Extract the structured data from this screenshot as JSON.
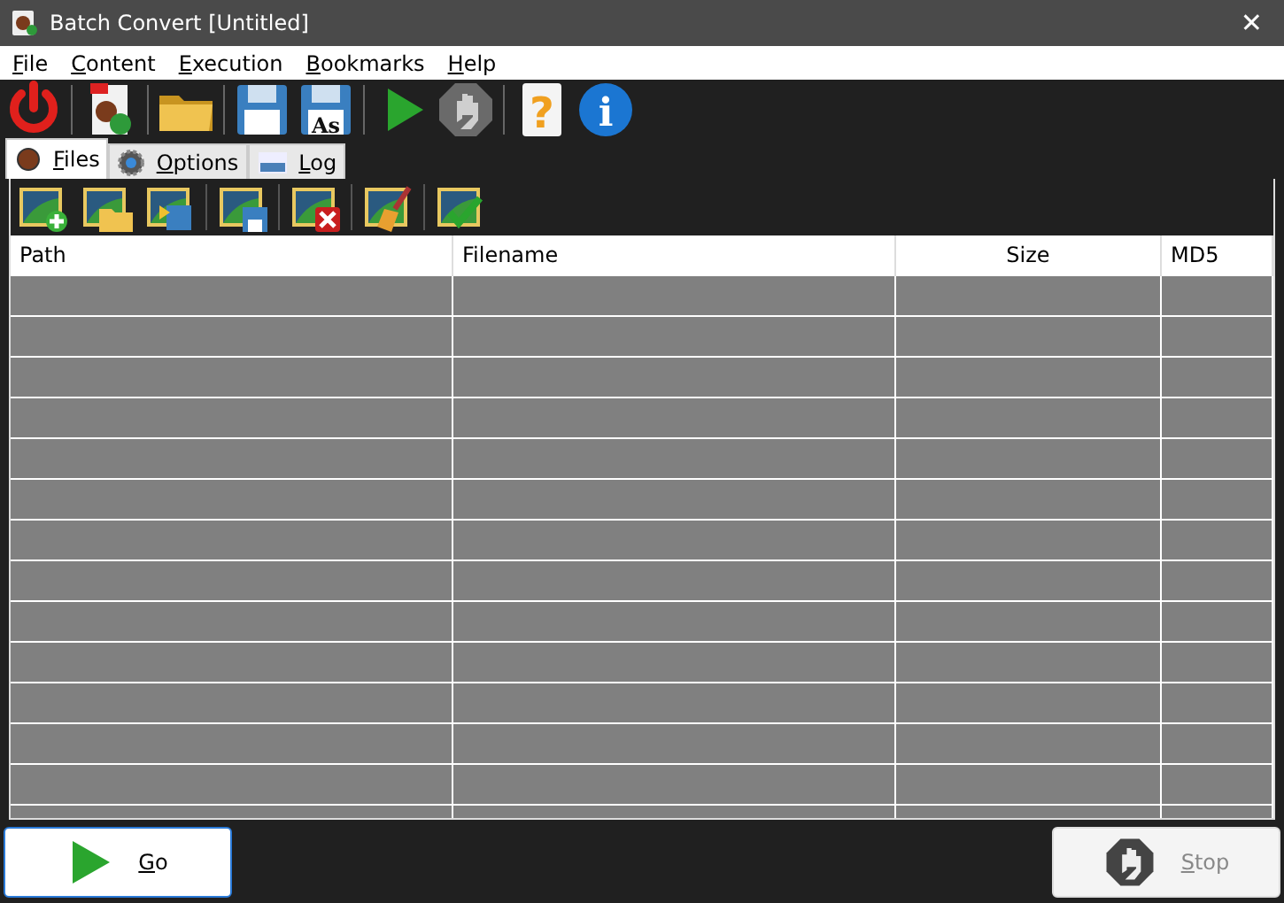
{
  "window": {
    "title": "Batch Convert [Untitled]",
    "close": "✕"
  },
  "menu": [
    "File",
    "Content",
    "Execution",
    "Bookmarks",
    "Help"
  ],
  "toolbar": [
    [
      {
        "kind": "power",
        "disabled": false
      }
    ],
    [
      {
        "kind": "open-job",
        "disabled": false
      }
    ],
    [
      {
        "kind": "folder",
        "disabled": false
      }
    ],
    [
      {
        "kind": "save",
        "disabled": false
      },
      {
        "kind": "save-as",
        "label": "As",
        "disabled": false
      }
    ],
    [
      {
        "kind": "play",
        "disabled": false
      },
      {
        "kind": "stop",
        "disabled": true
      }
    ],
    [
      {
        "kind": "help",
        "glyph": "?",
        "disabled": false
      },
      {
        "kind": "info",
        "glyph": "i",
        "disabled": false
      }
    ]
  ],
  "tabs": [
    {
      "label": "Files",
      "kind": "files",
      "selected": true
    },
    {
      "label": "Options",
      "kind": "options",
      "selected": false
    },
    {
      "label": "Log",
      "kind": "log",
      "selected": false
    }
  ],
  "files_toolbar": [
    [
      {
        "kind": "add"
      },
      {
        "kind": "add-folder"
      },
      {
        "kind": "import"
      }
    ],
    [
      {
        "kind": "save-list"
      }
    ],
    [
      {
        "kind": "remove"
      }
    ],
    [
      {
        "kind": "clear"
      }
    ],
    [
      {
        "kind": "check"
      }
    ]
  ],
  "table": {
    "columns": [
      {
        "label": "Path",
        "kind": "text"
      },
      {
        "label": "Filename",
        "kind": "text"
      },
      {
        "label": "Size",
        "kind": "number"
      },
      {
        "label": "MD5",
        "kind": "text"
      }
    ]
  },
  "buttons": [
    {
      "kind": "go",
      "label": "Go",
      "disabled": false
    },
    {
      "kind": "stop",
      "label": "Stop",
      "disabled": true
    }
  ]
}
